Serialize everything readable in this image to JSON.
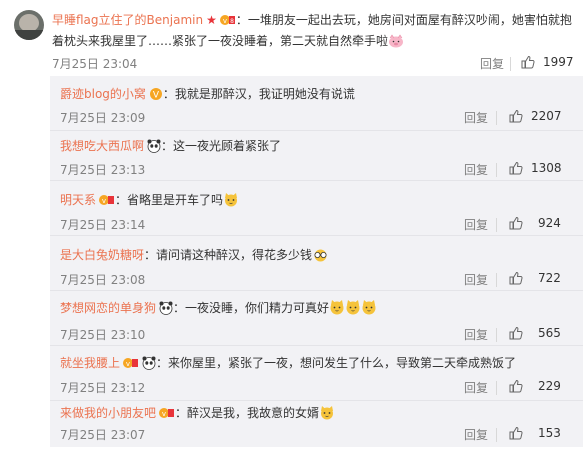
{
  "main_comment": {
    "username": "早睡flag立住了的Benjamin",
    "text_part1": "：一堆朋友一起出去玩，她房间对面屋有醉汉吵闹，她害怕就抱",
    "text_part2": "着枕头来我屋里了……紧张了一夜没睡着，第二天就自然牵手啦",
    "timestamp": "7月25日 23:04",
    "reply_label": "回复",
    "likes": "1997"
  },
  "replies": [
    {
      "username": "爵迹blog的小窝",
      "text": "：我就是那醉汉，我证明她没有说谎",
      "timestamp": "7月25日 23:09",
      "reply_label": "回复",
      "likes": "2207",
      "badge": "gold-v-icon"
    },
    {
      "username": "我想吃大西瓜啊",
      "text": "：这一夜光顾着紧张了",
      "timestamp": "7月25日 23:13",
      "reply_label": "回复",
      "likes": "1308",
      "badge": "panda-icon"
    },
    {
      "username": "明天系",
      "text": "：省略里是开车了吗",
      "timestamp": "7月25日 23:14",
      "reply_label": "回复",
      "likes": "924",
      "badge": "vip-icon"
    },
    {
      "username": "是大白兔奶糖呀",
      "text": "：请问请这种醉汉，得花多少钱",
      "timestamp": "7月25日 23:08",
      "reply_label": "回复",
      "likes": "722",
      "badge": ""
    },
    {
      "username": "梦想网恋的单身狗",
      "text": "一夜没睡，你们精力可真好",
      "timestamp": "7月25日 23:10",
      "reply_label": "回复",
      "likes": "565",
      "badge": "panda-icon"
    },
    {
      "username": "就坐我腰上",
      "text": "：来你屋里，紧张了一夜，想问发生了什么，导致第二天牵成熟饭了",
      "timestamp": "7月25日 23:12",
      "reply_label": "回复",
      "likes": "229",
      "badge": "vip-panda"
    },
    {
      "username": "来做我的小朋友吧",
      "text": "：醉汉是我，我故意的女婿",
      "timestamp": "7月25日 23:07",
      "reply_label": "回复",
      "likes": "153",
      "badge": "vip-icon"
    }
  ]
}
